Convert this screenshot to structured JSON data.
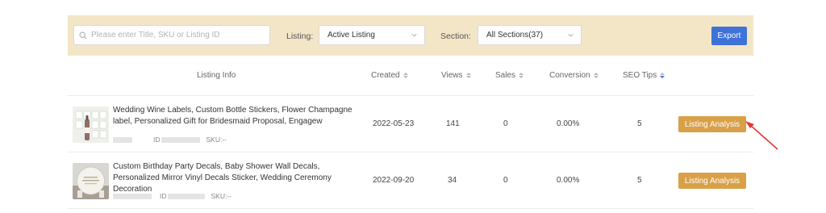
{
  "filters": {
    "search_placeholder": "Please enter Title, SKU or Listing ID",
    "listing_label": "Listing:",
    "listing_value": "Active Listing",
    "section_label": "Section:",
    "section_value": "All Sections(37)",
    "export_label": "Export"
  },
  "table": {
    "headers": {
      "info": "Listing Info",
      "created": "Created",
      "views": "Views",
      "sales": "Sales",
      "conversion": "Conversion",
      "seo": "SEO Tips"
    },
    "rows": [
      {
        "title": "Wedding Wine Labels, Custom Bottle Stickers, Flower Champagne label, Personalized Gift for Bridesmaid Proposal, Engagew",
        "id_label": "ID",
        "sku_label": "SKU:--",
        "created": "2022-05-23",
        "views": "141",
        "sales": "0",
        "conversion": "0.00%",
        "seo": "5",
        "action": "Listing Analysis"
      },
      {
        "title": "Custom Birthday Party Decals, Baby Shower Wall Decals, Personalized Mirror Vinyl Decals Sticker, Wedding Ceremony Decoration",
        "id_label": "ID",
        "sku_label": "SKU:--",
        "created": "2022-09-20",
        "views": "34",
        "sales": "0",
        "conversion": "0.00%",
        "seo": "5",
        "action": "Listing Analysis"
      }
    ]
  },
  "colors": {
    "filter_bg": "#f3e6c7",
    "export_bg": "#3f72d9",
    "analysis_bg": "#d9a047",
    "annotation_arrow": "#e03a33"
  }
}
